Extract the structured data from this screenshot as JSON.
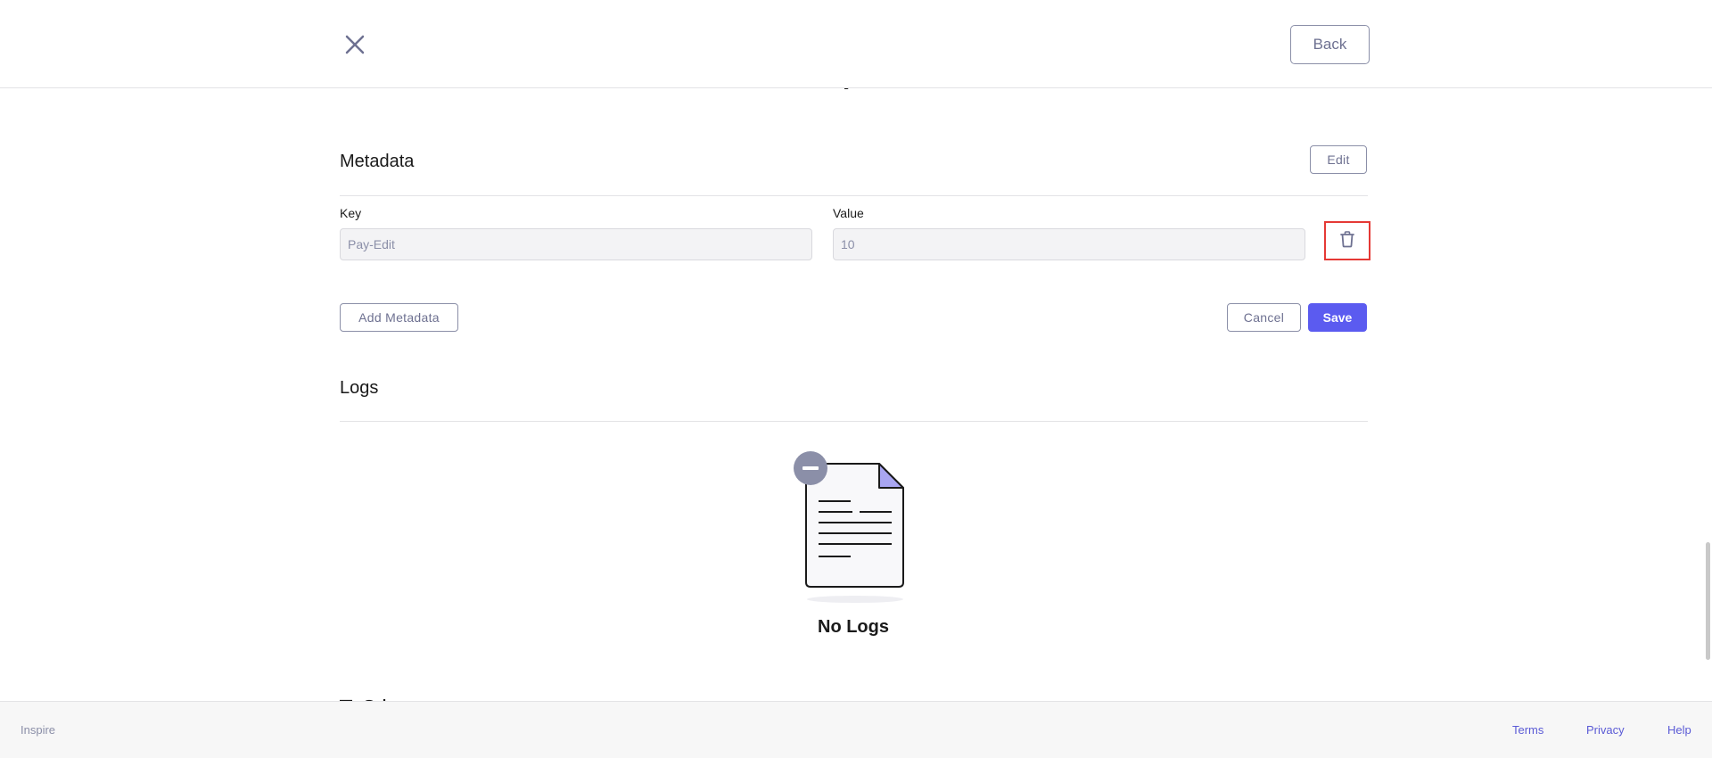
{
  "header": {
    "close_icon": "close-icon",
    "back_label": "Back"
  },
  "metadata": {
    "title": "Metadata",
    "edit_label": "Edit",
    "key_label": "Key",
    "value_label": "Value",
    "rows": [
      {
        "key": "Pay-Edit",
        "value": "10"
      }
    ],
    "delete_icon": "trash-icon",
    "add_label": "Add Metadata",
    "cancel_label": "Cancel",
    "save_label": "Save"
  },
  "logs": {
    "title": "Logs",
    "empty_icon": "empty-document-icon",
    "empty_text": "No Logs"
  },
  "footer": {
    "brand": "Inspire",
    "links": [
      "Terms",
      "Privacy",
      "Help"
    ]
  },
  "colors": {
    "accent": "#5b5bf0",
    "highlight_border": "#e53935",
    "muted_text": "#6e7191"
  }
}
